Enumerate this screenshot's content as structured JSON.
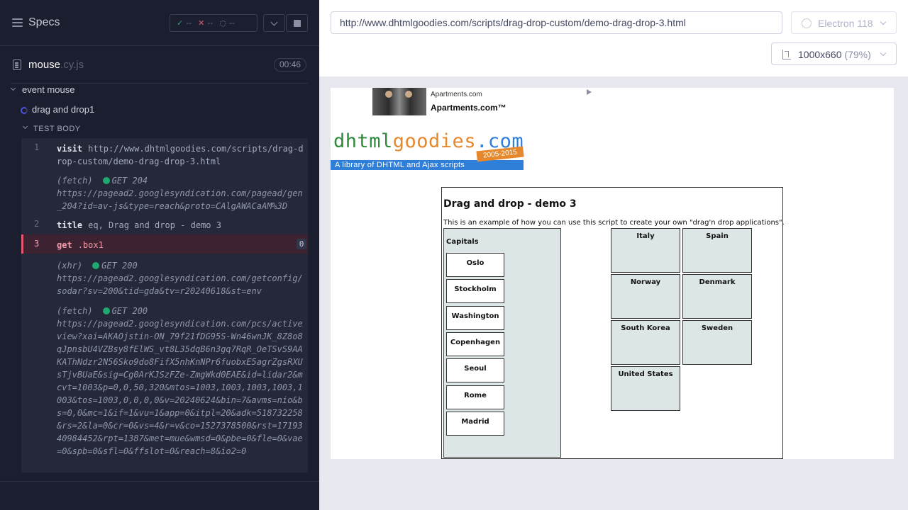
{
  "reporter": {
    "header": {
      "title": "Specs",
      "passed": "--",
      "failed": "--",
      "pending": "--"
    },
    "file": {
      "name": "mouse",
      "ext": ".cy.js",
      "duration": "00:46"
    },
    "suite": "event mouse",
    "test": "drag and drop1",
    "test_body_label": "TEST BODY",
    "commands": [
      {
        "num": "1",
        "name": "visit",
        "message": "http://www.dhtmlgoodies.com/scripts/drag-drop-custom/demo-drag-drop-3.html"
      },
      {
        "kind": "(fetch)",
        "method": "GET 204",
        "url": "https://pagead2.googlesyndication.com/pagead/gen_204?id=av-js&type=reach&proto=CAlgAWACaAM%3D"
      },
      {
        "num": "2",
        "name": "title",
        "message": "eq, Drag and drop - demo 3"
      },
      {
        "num": "3",
        "name": "get",
        "message": ".box1",
        "badge": "0"
      },
      {
        "kind": "(xhr)",
        "method": "GET 200",
        "url": "https://pagead2.googlesyndication.com/getconfig/sodar?sv=200&tid=gda&tv=r20240618&st=env"
      },
      {
        "kind": "(fetch)",
        "method": "GET 200",
        "url": "https://pagead2.googlesyndication.com/pcs/activeview?xai=AKAOjstin-ON_79f21fDG95S-Wn46wnJK_8Z8o8qJpnsbU4VZBsy8fElWS_vt8L35dqB6n3gq7RqR_OeTSvS9AAKAThNdzr2N56Sko9do8FifX5nhKnNPr6fuobxE5agrZgsRXUsTjvBUaE&sig=Cg0ArKJSzFZe-ZmgWkd0EAE&id=lidar2&mcvt=1003&p=0,0,50,320&mtos=1003,1003,1003,1003,1003&tos=1003,0,0,0,0&v=20240624&bin=7&avms=nio&bs=0,0&mc=1&if=1&vu=1&app=0&itpl=20&adk=518732258&rs=2&la=0&cr=0&vs=4&r=v&co=1527378500&rst=1719340984452&rpt=1387&met=mue&wmsd=0&pbe=0&fle=0&vae=0&spb=0&sfl=0&ffslot=0&reach=8&io2=0"
      }
    ]
  },
  "aut": {
    "url": "http://www.dhtmlgoodies.com/scripts/drag-drop-custom/demo-drag-drop-3.html",
    "browser": "Electron 118",
    "viewport": "1000x660",
    "zoom": "(79%)"
  },
  "page": {
    "ad": {
      "small": "Apartments.com",
      "big": "Apartments.com™"
    },
    "logo": {
      "part1": "dhtml",
      "part2": "goodies",
      "part3": ".com",
      "years": "2005-2015",
      "tagline": "A library of DHTML and Ajax scripts"
    },
    "demo": {
      "title": "Drag and drop - demo 3",
      "intro": "This is an example of how you can use this script to create your own \"drag'n drop applications\".",
      "capitals_title": "Capitals",
      "capitals": [
        "Oslo",
        "Stockholm",
        "Washington",
        "Copenhagen",
        "Seoul",
        "Rome",
        "Madrid"
      ],
      "countries": [
        "Italy",
        "Spain",
        "Norway",
        "Denmark",
        "South Korea",
        "Sweden",
        "United States"
      ]
    }
  }
}
